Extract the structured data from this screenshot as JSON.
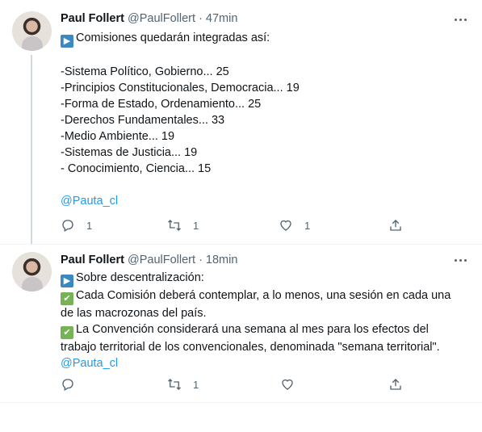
{
  "tweets": [
    {
      "author": "Paul Follert",
      "handle": "@PaulFollert",
      "time": "· 47min",
      "intro": "Comisiones quedarán integradas así:",
      "lines": [
        "-Sistema Político, Gobierno... 25",
        "-Principios Constitucionales, Democracia... 19",
        "-Forma de Estado, Ordenamiento... 25",
        "-Derechos Fundamentales... 33",
        "-Medio Ambiente... 19",
        "-Sistemas de Justicia... 19",
        "- Conocimiento, Ciencia... 15"
      ],
      "mention": "@Pauta_cl",
      "replies": "1",
      "retweets": "1",
      "likes": "1"
    },
    {
      "author": "Paul Follert",
      "handle": "@PaulFollert",
      "time": "· 18min",
      "intro": "Sobre descentralización:",
      "line1a": "Cada Comisión deberá contemplar, a lo menos, una sesión en cada una",
      "line1b": "de las macrozonas del país.",
      "line2a": "La Convención considerará una semana al mes para los efectos del",
      "line2b": "trabajo territorial de los convencionales, denominada \"semana territorial\".",
      "mention": "@Pauta_cl",
      "retweets": "1"
    }
  ],
  "icons": {
    "intro_emoji": "play-button-emoji",
    "bullet_emoji": "check-mark-emoji",
    "more": "more-icon",
    "reply": "reply-icon",
    "retweet": "retweet-icon",
    "like": "like-icon",
    "share": "share-icon"
  }
}
